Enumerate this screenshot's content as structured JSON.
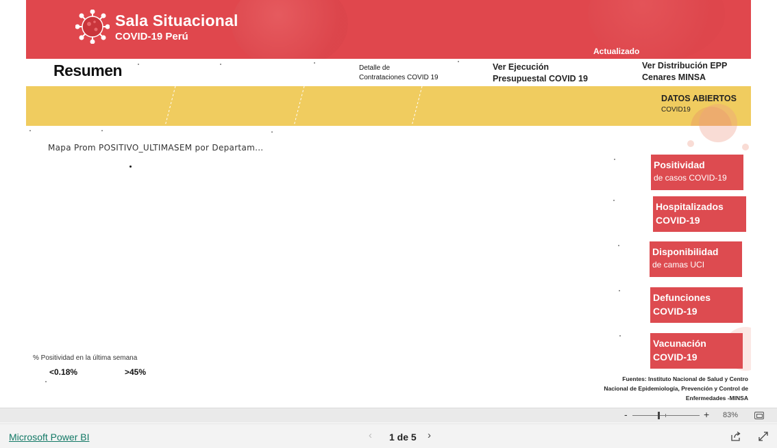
{
  "header": {
    "brand_title": "Sala Situacional",
    "brand_subtitle": "COVID-19 Perú",
    "updated_label": "Actualizado"
  },
  "page": {
    "title": "Resumen"
  },
  "links": {
    "contrataciones": [
      "Detalle  de",
      "Contrataciones COVID 19"
    ],
    "ejecucion": [
      "Ver Ejecución",
      "Presupuestal COVID 19"
    ],
    "distribucion": [
      "Ver Distribución EPP",
      "Cenares MINSA"
    ],
    "datos_abiertos": "DATOS ABIERTOS",
    "datos_abiertos_sub": "COVID19"
  },
  "map": {
    "title": "Mapa Prom POSITIVO_ULTIMASEM por Departam...",
    "legend_title": "% Positividad en la última semana",
    "legend_min": "<0.18%",
    "legend_max": ">45%"
  },
  "nav_buttons": [
    {
      "line1": "Positividad",
      "line2": "de casos COVID-19"
    },
    {
      "line1": "Hospitalizados",
      "line2": "COVID-19"
    },
    {
      "line1": "Disponibilidad",
      "line2": "de camas UCI"
    },
    {
      "line1": "Defunciones",
      "line2": "COVID-19"
    },
    {
      "line1": "Vacunación",
      "line2": "COVID-19"
    }
  ],
  "sources": [
    "Fuentes: Instituto Nacional de Salud y Centro",
    "Nacional de Epidemiología, Prevención y Control de",
    "Enfermedades -MINSA"
  ],
  "zoom": {
    "minus": "-",
    "plus": "+",
    "level": "83%"
  },
  "footer": {
    "powerbi_link": "Microsoft Power BI",
    "pager": "1 de 5",
    "prev": "‹",
    "next": "›"
  },
  "colors": {
    "header_red": "#e0474d",
    "button_red": "#dd4b50",
    "band_yellow": "#f0cc5f",
    "link_green": "#117865"
  }
}
